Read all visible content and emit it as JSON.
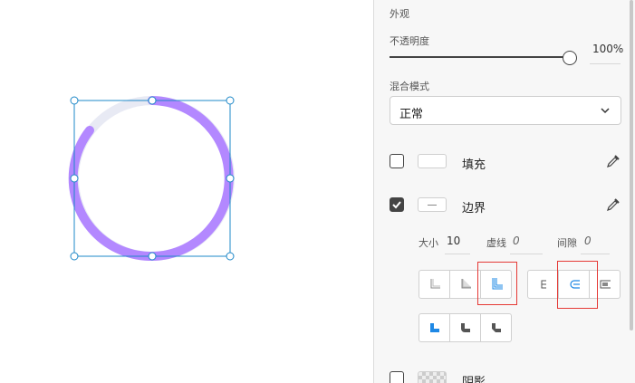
{
  "panel": {
    "appearance_label": "外观",
    "opacity": {
      "label": "不透明度",
      "value_text": "100%",
      "value": 1.0
    },
    "blend_mode": {
      "label": "混合模式",
      "selected": "正常"
    },
    "fill": {
      "label": "填充",
      "checked": false
    },
    "border": {
      "label": "边界",
      "checked": true,
      "size_label": "大小",
      "size_value": "10",
      "dash_label": "虚线",
      "dash_value": "0",
      "gap_label": "间隙",
      "gap_value": "0"
    },
    "shadow": {
      "label": "阴影",
      "checked": false
    }
  },
  "canvas": {
    "ring_color": "#b388ff",
    "ring_bg_color": "#e8eaf4",
    "selection_color": "#1e88c8"
  },
  "icons": {
    "dropdown": "chevron-down-icon",
    "eyedropper": "eyedropper-icon",
    "stroke_align": [
      "stroke-inner-icon",
      "stroke-center-icon",
      "stroke-outer-icon"
    ],
    "stroke_caps": [
      "cap-butt-icon",
      "cap-round-icon",
      "cap-square-icon"
    ],
    "stroke_joins": [
      "join-miter-icon",
      "join-round-icon",
      "join-bevel-icon"
    ]
  }
}
